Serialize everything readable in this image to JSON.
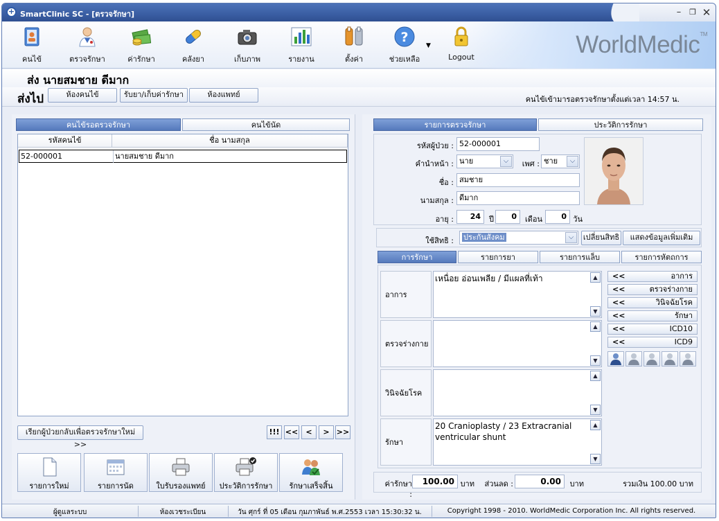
{
  "window": {
    "title": "SmartClinic SC - [ตรวจรักษา]",
    "brand": "WorldMedic",
    "brand_tm": "TM"
  },
  "toolbar": [
    {
      "label": "คนไข้",
      "icon": "patient-book-icon"
    },
    {
      "label": "ตรวจรักษา",
      "icon": "doctor-icon"
    },
    {
      "label": "ค่ารักษา",
      "icon": "money-icon"
    },
    {
      "label": "คลังยา",
      "icon": "pill-icon"
    },
    {
      "label": "เก็บภาพ",
      "icon": "camera-icon"
    },
    {
      "label": "รายงาน",
      "icon": "bar-chart-icon"
    },
    {
      "label": "ตั้งค่า",
      "icon": "tools-icon"
    },
    {
      "label": "ช่วยเหลือ",
      "icon": "help-icon"
    },
    {
      "label": "Logout",
      "icon": "lock-icon"
    }
  ],
  "header": {
    "patient_name": "ส่ง  นายสมชาย ดีมาก",
    "send_label": "ส่งไป",
    "send_buttons": [
      "ห้องคนไข้",
      "รับยา/เก็บค่ารักษา",
      "ห้องแพทย์"
    ],
    "wait_text": "คนไข้เข้ามารอตรวจรักษาตั้งแต่เวลา 14:57 น."
  },
  "left": {
    "tabs": [
      "คนไข้รอตรวจรักษา",
      "คนไข้นัด"
    ],
    "columns": [
      "รหัสคนไข้",
      "ชื่อ นามสกุล"
    ],
    "rows": [
      {
        "id": "52-000001",
        "name": "นายสมชาย ดีมาก"
      }
    ],
    "recall_button": "เรียกผู้ป่วยกลับเพื่อตรวจรักษาใหม่ >>",
    "nav": [
      "!!!",
      "<<",
      "<",
      ">",
      ">>"
    ],
    "actions": [
      {
        "label": "รายการใหม่",
        "icon": "new-document-icon"
      },
      {
        "label": "รายการนัด",
        "icon": "calendar-icon"
      },
      {
        "label": "ใบรับรองแพทย์",
        "icon": "printer-icon"
      },
      {
        "label": "ประวัติการรักษา",
        "icon": "printer-check-icon"
      },
      {
        "label": "รักษาเสร็จสิ้น",
        "icon": "users-check-icon"
      }
    ]
  },
  "right": {
    "tabs": [
      "รายการตรวจรักษา",
      "ประวัติการรักษา"
    ],
    "form": {
      "patient_id_label": "รหัสผู้ป่วย :",
      "patient_id": "52-000001",
      "prefix_label": "คำนำหน้า :",
      "prefix": "นาย",
      "sex_label": "เพศ :",
      "sex": "ชาย",
      "first_name_label": "ชื่อ :",
      "first_name": "สมชาย",
      "last_name_label": "นามสกุล :",
      "last_name": "ดีมาก",
      "age_label": "อายุ :",
      "age_years": "24",
      "years_unit": "ปี",
      "age_months": "0",
      "months_unit": "เดือน",
      "age_days": "0",
      "days_unit": "วัน",
      "rights_label": "ใช้สิทธิ :",
      "rights": "ประกันสังคม",
      "change_rights": "เปลี่ยนสิทธิ",
      "more_info": "แสดงข้อมูลเพิ่มเติม"
    },
    "sub_tabs": [
      "การรักษา",
      "รายการยา",
      "รายการแล็บ",
      "รายการหัตถการ"
    ],
    "sections": [
      {
        "label": "อาการ",
        "text": "เหนื่อย อ่อนเพลีย / มีแผลที่เท้า"
      },
      {
        "label": "ตรวจร่างกาย",
        "text": ""
      },
      {
        "label": "วินิจฉัยโรค",
        "text": ""
      },
      {
        "label": "รักษา",
        "text": "20 Cranioplasty / 23 Extracranial ventricular shunt"
      }
    ],
    "side_buttons": [
      "อาการ",
      "ตรวจร่างกาย",
      "วินิจฉัยโรค",
      "รักษา",
      "ICD10",
      "ICD9"
    ],
    "side_chevron": "<<",
    "fees": {
      "fee_label": "ค่ารักษา :",
      "fee": "100.00",
      "baht": "บาท",
      "discount_label": "ส่วนลด :",
      "discount": "0.00",
      "total": "รวมเงิน 100.00 บาท"
    }
  },
  "status": [
    "ผู้ดูแลระบบ",
    "ห้องเวชระเบียน",
    "วัน ศุกร์ ที่ 05 เดือน กุมภาพันธ์ พ.ศ.2553 เวลา 15:30:32 น.",
    "Copyright 1998 - 2010. WorldMedic Corporation Inc. All rights reserved."
  ]
}
